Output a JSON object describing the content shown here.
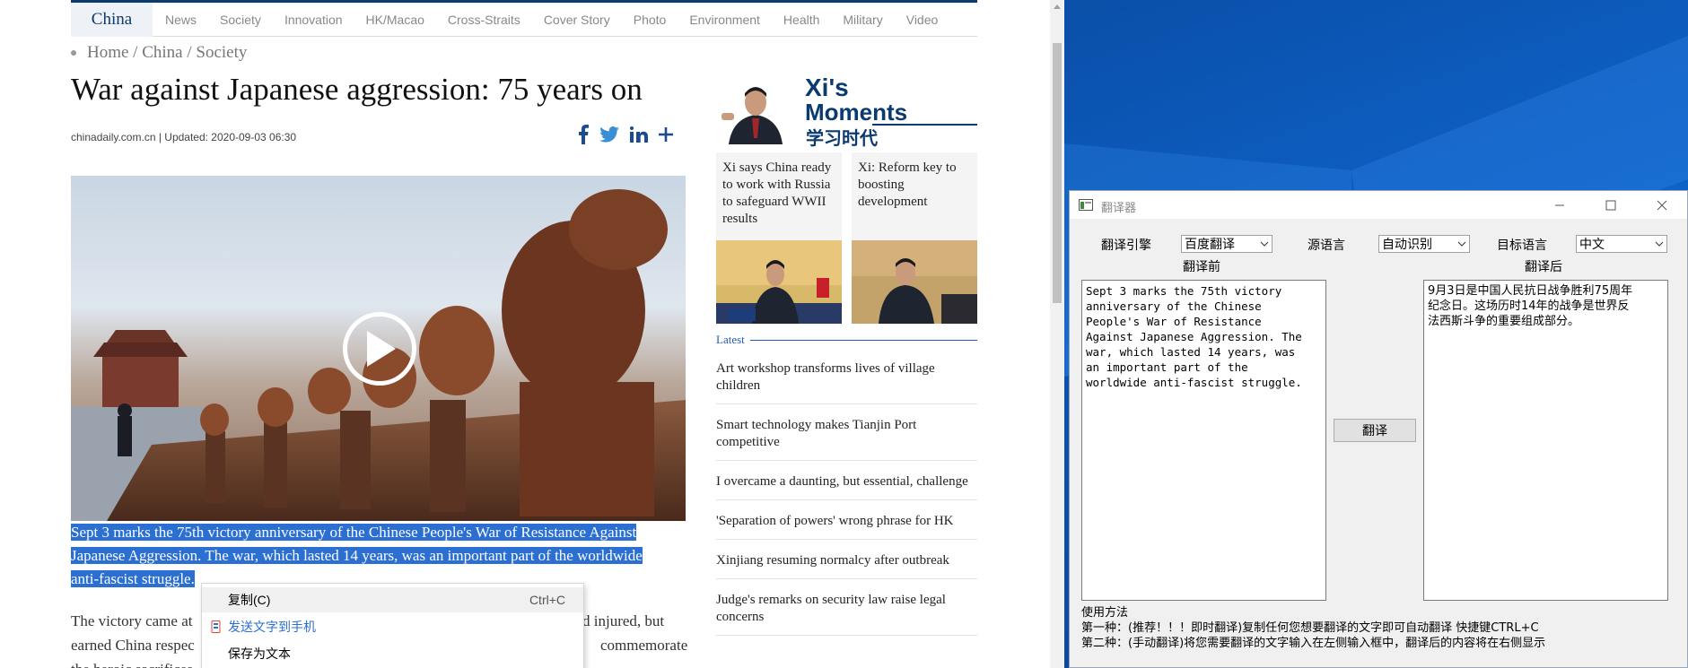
{
  "browser": {
    "nav": {
      "brand": "China",
      "items": [
        "News",
        "Society",
        "Innovation",
        "HK/Macao",
        "Cross-Straits",
        "Cover Story",
        "Photo",
        "Environment",
        "Health",
        "Military",
        "Video"
      ]
    },
    "breadcrumb": "Home / China / Society",
    "headline": "War against Japanese aggression: 75 years on",
    "meta": "chinadaily.com.cn | Updated: 2020-09-03 06:30",
    "share": [
      "facebook-icon",
      "twitter-icon",
      "linkedin-icon",
      "more-share-icon"
    ],
    "caption_lines": [
      "Sept 3 marks the 75th victory anniversary of the Chinese People's War of Resistance Against",
      "Japanese Aggression. The war, which lasted 14 years, was an important part of the worldwide",
      "anti-fascist struggle."
    ],
    "body_lines": [
      "The victory came at",
      "d injured, but",
      "earned China respec",
      "commemorate",
      "the heroic sacrifices"
    ],
    "context_menu": {
      "copy": "复制(C)",
      "copy_shortcut": "Ctrl+C",
      "send_to_phone": "发送文字到手机",
      "save_as_text": "保存为文本"
    },
    "sidebar": {
      "banner_title_1": "Xi's",
      "banner_title_2": "Moments",
      "banner_cn": "学习时代",
      "cards": [
        "Xi says China ready to work with Russia to safeguard WWII results",
        "Xi: Reform key to boosting development"
      ],
      "latest_label": "Latest",
      "latest": [
        "Art workshop transforms lives of village children",
        "Smart technology makes Tianjin Port competitive",
        "I overcame a daunting, but essential, challenge",
        "'Separation of powers' wrong phrase for HK",
        "Xinjiang resuming normalcy after outbreak",
        "Judge's remarks on security law raise legal concerns"
      ]
    }
  },
  "translator": {
    "title": "翻译器",
    "engine_label": "翻译引擎",
    "engine_value": "百度翻译",
    "source_label": "源语言",
    "source_value": "自动识别",
    "target_label": "目标语言",
    "target_value": "中文",
    "before_label": "翻译前",
    "after_label": "翻译后",
    "input_text": "Sept 3 marks the 75th victory\nanniversary of the Chinese\nPeople's War of Resistance\nAgainst Japanese Aggression. The\nwar, which lasted 14 years, was\nan important part of the\nworldwide anti-fascist struggle.",
    "output_text": "9月3日是中国人民抗日战争胜利75周年\n纪念日。这场历时14年的战争是世界反\n法西斯斗争的重要组成部分。",
    "translate_button": "翻译",
    "usage_title": "使用方法",
    "usage_1": "第一种：(推荐！！！即时翻译)复制任何您想要翻译的文字即可自动翻译 快捷键CTRL+C",
    "usage_2": "第二种：(手动翻译)将您需要翻译的文字输入在左侧输入框中，翻译后的内容将在右侧显示"
  },
  "colors": {
    "brand_navy": "#0b3a6e",
    "selection_blue": "#2b6fd2",
    "desktop_blue": "#0e63c9"
  }
}
